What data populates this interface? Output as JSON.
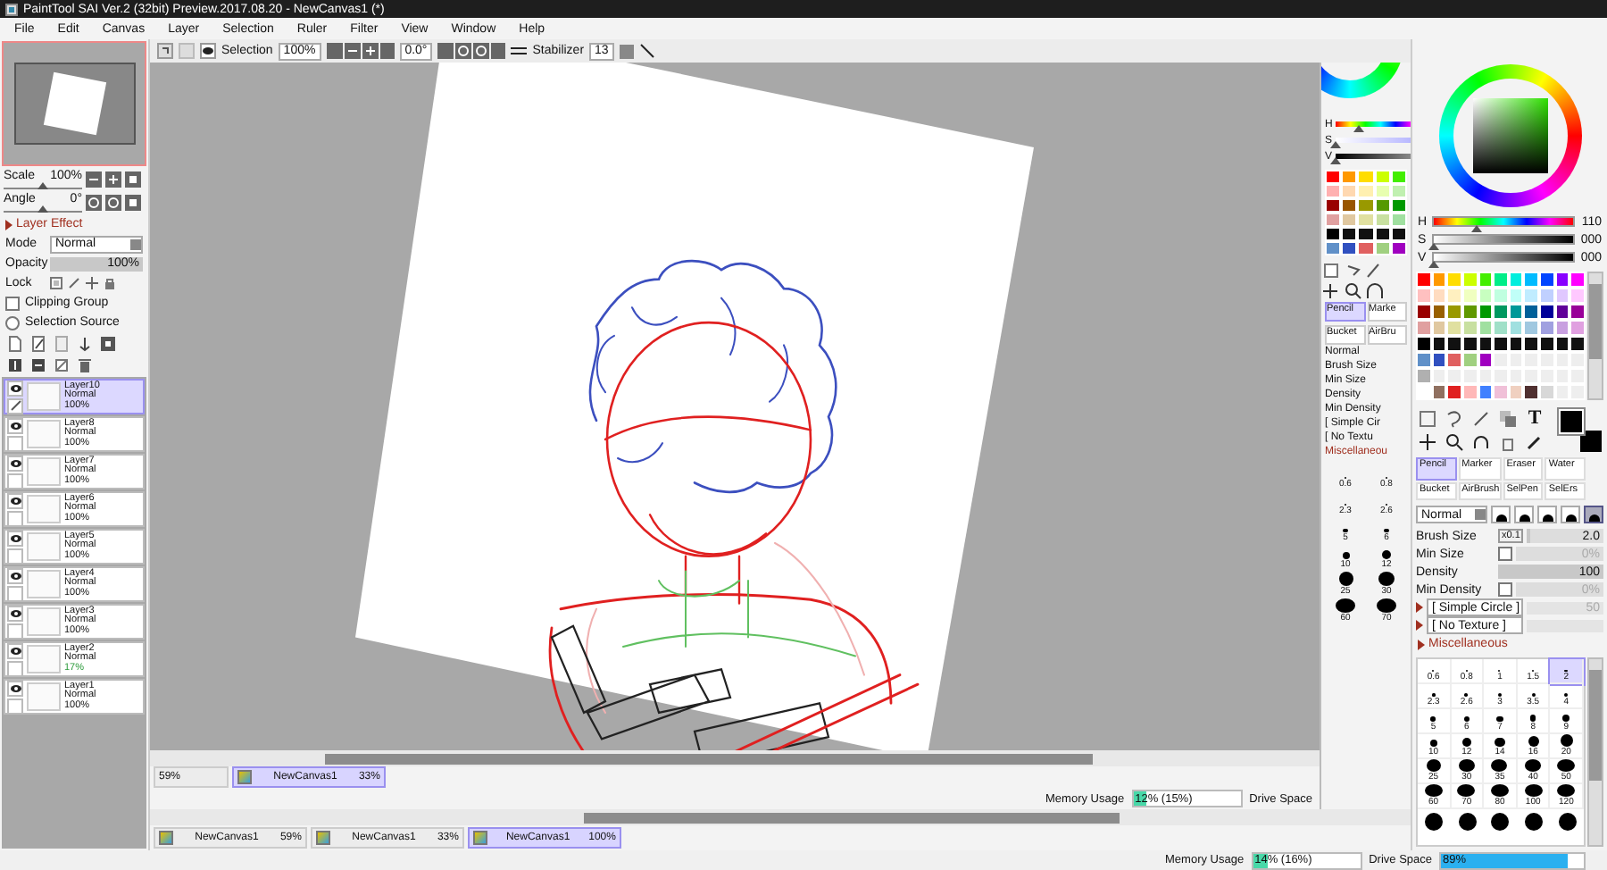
{
  "window": {
    "title": "PaintTool SAI Ver.2 (32bit) Preview.2017.08.20 - NewCanvas1 (*)"
  },
  "menu": [
    "File",
    "Edit",
    "Canvas",
    "Layer",
    "Selection",
    "Ruler",
    "Filter",
    "View",
    "Window",
    "Help"
  ],
  "toolbar": {
    "selection_label": "Selection",
    "selection_checked": true,
    "zoom": "100%",
    "angle": "0.0°",
    "stabilizer_label": "Stabilizer",
    "stabilizer": "13"
  },
  "navigator": {
    "scale": {
      "label": "Scale",
      "value": "100%",
      "level": 0.5
    },
    "angle": {
      "label": "Angle",
      "value": "0°",
      "level": 0.5
    }
  },
  "layer_panel": {
    "heading": "Layer Effect",
    "mode_label": "Mode",
    "mode": "Normal",
    "opacity": {
      "label": "Opacity",
      "value": "100%",
      "level": 1
    },
    "lock_label": "Lock",
    "options": [
      {
        "label": "Clipping Group",
        "kind": "checkbox",
        "checked": false
      },
      {
        "label": "Selection Source",
        "kind": "radio",
        "checked": false
      }
    ]
  },
  "layers": [
    {
      "name": "Layer10",
      "mode": "Normal",
      "opacity": "100%",
      "reduced": false,
      "visible": true,
      "editing": true,
      "selected": true
    },
    {
      "name": "Layer8",
      "mode": "Normal",
      "opacity": "100%",
      "reduced": false,
      "visible": true,
      "editing": false,
      "selected": false
    },
    {
      "name": "Layer7",
      "mode": "Normal",
      "opacity": "100%",
      "reduced": false,
      "visible": true,
      "editing": false,
      "selected": false
    },
    {
      "name": "Layer6",
      "mode": "Normal",
      "opacity": "100%",
      "reduced": false,
      "visible": true,
      "editing": false,
      "selected": false
    },
    {
      "name": "Layer5",
      "mode": "Normal",
      "opacity": "100%",
      "reduced": false,
      "visible": true,
      "editing": false,
      "selected": false
    },
    {
      "name": "Layer4",
      "mode": "Normal",
      "opacity": "100%",
      "reduced": false,
      "visible": true,
      "editing": false,
      "selected": false
    },
    {
      "name": "Layer3",
      "mode": "Normal",
      "opacity": "100%",
      "reduced": false,
      "visible": true,
      "editing": false,
      "selected": false
    },
    {
      "name": "Layer2",
      "mode": "Normal",
      "opacity": "17%",
      "reduced": true,
      "visible": true,
      "editing": false,
      "selected": false
    },
    {
      "name": "Layer1",
      "mode": "Normal",
      "opacity": "100%",
      "reduced": false,
      "visible": true,
      "editing": false,
      "selected": false
    }
  ],
  "inner_view": {
    "sliders": [
      {
        "label": "H",
        "level": 0.31
      },
      {
        "label": "S",
        "level": 0
      },
      {
        "label": "V",
        "level": 0
      }
    ],
    "swatch_rows": [
      {
        "swatches": [
          {
            "color": "#ff0000"
          },
          {
            "color": "#ff9900"
          },
          {
            "color": "#ffdd00"
          },
          {
            "color": "#ccff00"
          },
          {
            "color": "#44ee00"
          }
        ]
      },
      {
        "swatches": [
          {
            "color": "#ffb0b0"
          },
          {
            "color": "#ffd8b0"
          },
          {
            "color": "#fff0b0"
          },
          {
            "color": "#e8ffb0"
          },
          {
            "color": "#c0f0b0"
          }
        ]
      },
      {
        "swatches": [
          {
            "color": "#990000"
          },
          {
            "color": "#995500"
          },
          {
            "color": "#999900"
          },
          {
            "color": "#559900"
          },
          {
            "color": "#009900"
          }
        ]
      },
      {
        "swatches": [
          {
            "color": "#e0a0a0"
          },
          {
            "color": "#e0c8a0"
          },
          {
            "color": "#e0e0a0"
          },
          {
            "color": "#c8e0a0"
          },
          {
            "color": "#a0e0a0"
          }
        ]
      },
      {
        "swatches": [
          {
            "color": "#000000"
          },
          {
            "color": "#111111"
          },
          {
            "color": "#111111"
          },
          {
            "color": "#111111"
          },
          {
            "color": "#111111"
          }
        ]
      },
      {
        "swatches": [
          {
            "color": "#6090c8"
          },
          {
            "color": "#3050c0"
          },
          {
            "color": "#e06060"
          },
          {
            "color": "#a0d080"
          },
          {
            "color": "#a000c0"
          }
        ]
      }
    ],
    "tool_tabs": [
      {
        "label": "Pencil",
        "selected": true
      },
      {
        "label": "Marke",
        "selected": false
      },
      {
        "label": "Bucket",
        "selected": false
      },
      {
        "label": "AirBru",
        "selected": false
      }
    ],
    "mode": "Normal",
    "labels": [
      "Brush Size",
      "Min Size",
      "Density",
      "Min Density"
    ],
    "dropdowns": [
      "[ Simple Cir",
      "[ No Textu"
    ],
    "section": "Miscellaneou",
    "sizes": [
      "0.6",
      "0.8",
      "2.3",
      "2.6",
      "5",
      "6",
      "10",
      "12",
      "25",
      "30",
      "60",
      "70"
    ],
    "tabs": [
      {
        "zoom": "59%",
        "selected": false
      },
      {
        "name": "NewCanvas1",
        "zoom": "33%",
        "selected": true
      }
    ],
    "memory": {
      "label": "Memory Usage",
      "value": "12% (15%)",
      "level": 0.12
    },
    "drive_label": "Drive Space"
  },
  "tabs": [
    {
      "name": "NewCanvas1",
      "zoom": "59%",
      "selected": false
    },
    {
      "name": "NewCanvas1",
      "zoom": "33%",
      "selected": false
    },
    {
      "name": "NewCanvas1",
      "zoom": "100%",
      "selected": true
    }
  ],
  "color": {
    "sliders": [
      {
        "label": "H",
        "value": "110",
        "level": 0.31
      },
      {
        "label": "S",
        "value": "000",
        "level": 0
      },
      {
        "label": "V",
        "value": "000",
        "level": 0
      }
    ],
    "swatch_rows": [
      {
        "swatches": [
          {
            "color": "#ff0000"
          },
          {
            "color": "#ff9900"
          },
          {
            "color": "#ffdd00"
          },
          {
            "color": "#ccff00"
          },
          {
            "color": "#44ee00"
          },
          {
            "color": "#00ee88"
          },
          {
            "color": "#00eedd"
          },
          {
            "color": "#00bbff"
          },
          {
            "color": "#0044ff"
          },
          {
            "color": "#8800ff"
          },
          {
            "color": "#ff00ff"
          }
        ]
      },
      {
        "swatches": [
          {
            "color": "#ffc0c0"
          },
          {
            "color": "#ffdcc0"
          },
          {
            "color": "#fff0c0"
          },
          {
            "color": "#f0ffc0"
          },
          {
            "color": "#c8ffc0"
          },
          {
            "color": "#c0ffe0"
          },
          {
            "color": "#c0fff8"
          },
          {
            "color": "#c0ecff"
          },
          {
            "color": "#c0d0ff"
          },
          {
            "color": "#e0c8ff"
          },
          {
            "color": "#ffc8ff"
          }
        ]
      },
      {
        "swatches": [
          {
            "color": "#990000"
          },
          {
            "color": "#996000"
          },
          {
            "color": "#999900"
          },
          {
            "color": "#609900"
          },
          {
            "color": "#009900"
          },
          {
            "color": "#009960"
          },
          {
            "color": "#009999"
          },
          {
            "color": "#006099"
          },
          {
            "color": "#000099"
          },
          {
            "color": "#600099"
          },
          {
            "color": "#990099"
          }
        ]
      },
      {
        "swatches": [
          {
            "color": "#e0a0a0"
          },
          {
            "color": "#e0c8a0"
          },
          {
            "color": "#e0e0a0"
          },
          {
            "color": "#c8e0a0"
          },
          {
            "color": "#a0e0a0"
          },
          {
            "color": "#a0e0c8"
          },
          {
            "color": "#a0e0e0"
          },
          {
            "color": "#a0c8e0"
          },
          {
            "color": "#a0a0e0"
          },
          {
            "color": "#c8a0e0"
          },
          {
            "color": "#e0a0e0"
          }
        ]
      },
      {
        "swatches": [
          {
            "color": "#000000"
          },
          {
            "color": "#111111"
          },
          {
            "color": "#111111"
          },
          {
            "color": "#111111"
          },
          {
            "color": "#111111"
          },
          {
            "color": "#111111"
          },
          {
            "color": "#111111"
          },
          {
            "color": "#111111"
          },
          {
            "color": "#111111"
          },
          {
            "color": "#111111"
          },
          {
            "color": "#111111"
          }
        ]
      },
      {
        "swatches": [
          {
            "color": "#6090c8"
          },
          {
            "color": "#3050c0"
          },
          {
            "color": "#e06060"
          },
          {
            "color": "#a0d080"
          },
          {
            "color": "#a000c0"
          }
        ]
      },
      {
        "swatches": [
          {
            "color": "#b0b0b0"
          }
        ]
      },
      {
        "swatches": [
          {
            "color": "#ffffff"
          },
          {
            "color": "#907060"
          },
          {
            "color": "#e02020"
          },
          {
            "color": "#ffb8b8"
          },
          {
            "color": "#4080ff"
          },
          {
            "color": "#f0c0d8"
          },
          {
            "color": "#f0d0c0"
          },
          {
            "color": "#503030"
          },
          {
            "color": "#d8d8d8"
          }
        ]
      }
    ]
  },
  "tools": {
    "text_glyph": "T"
  },
  "tool_tabs": [
    {
      "label": "Pencil",
      "selected": true
    },
    {
      "label": "Marker",
      "selected": false
    },
    {
      "label": "Eraser",
      "selected": false
    },
    {
      "label": "Water",
      "selected": false
    },
    {
      "label": "Bucket",
      "selected": false
    },
    {
      "label": "AirBrush",
      "selected": false
    },
    {
      "label": "SelPen",
      "selected": false
    },
    {
      "label": "SelErs",
      "selected": false
    }
  ],
  "brush": {
    "mode": "Normal",
    "shapes": [
      {
        "selected": false
      },
      {
        "selected": false
      },
      {
        "selected": false
      },
      {
        "selected": false
      },
      {
        "selected": true
      }
    ],
    "settings": [
      {
        "label": "Brush Size",
        "kind": "slider",
        "multiplier": "x0.1",
        "value": "2.0",
        "level": 0.04
      },
      {
        "label": "Min Size",
        "kind": "check-slider",
        "checked": false,
        "value": "0%",
        "level": 0
      },
      {
        "label": "Density",
        "kind": "slider",
        "value": "100",
        "level": 1
      },
      {
        "label": "Min Density",
        "kind": "check-slider",
        "checked": false,
        "value": "0%",
        "level": 0
      }
    ],
    "dropdowns": [
      {
        "label": "[ Simple Circle ]",
        "value": "50"
      },
      {
        "label": "[ No Texture ]"
      }
    ],
    "section": "Miscellaneous",
    "sizes": [
      {
        "label": "0.6",
        "selected": false
      },
      {
        "label": "0.8",
        "selected": false
      },
      {
        "label": "1",
        "selected": false
      },
      {
        "label": "1.5",
        "selected": false
      },
      {
        "label": "2",
        "selected": true
      },
      {
        "label": "2.3",
        "selected": false
      },
      {
        "label": "2.6",
        "selected": false
      },
      {
        "label": "3",
        "selected": false
      },
      {
        "label": "3.5",
        "selected": false
      },
      {
        "label": "4",
        "selected": false
      },
      {
        "label": "5",
        "selected": false
      },
      {
        "label": "6",
        "selected": false
      },
      {
        "label": "7",
        "selected": false
      },
      {
        "label": "8",
        "selected": false
      },
      {
        "label": "9",
        "selected": false
      },
      {
        "label": "10",
        "selected": false
      },
      {
        "label": "12",
        "selected": false
      },
      {
        "label": "14",
        "selected": false
      },
      {
        "label": "16",
        "selected": false
      },
      {
        "label": "20",
        "selected": false
      },
      {
        "label": "25",
        "selected": false
      },
      {
        "label": "30",
        "selected": false
      },
      {
        "label": "35",
        "selected": false
      },
      {
        "label": "40",
        "selected": false
      },
      {
        "label": "50",
        "selected": false
      },
      {
        "label": "60",
        "selected": false
      },
      {
        "label": "70",
        "selected": false
      },
      {
        "label": "80",
        "selected": false
      },
      {
        "label": "100",
        "selected": false
      },
      {
        "label": "120",
        "selected": false
      }
    ]
  },
  "status": {
    "memory": {
      "label": "Memory Usage",
      "value": "14% (16%)",
      "level": 0.14
    },
    "drive": {
      "label": "Drive Space",
      "value": "89%",
      "level": 0.89
    }
  }
}
